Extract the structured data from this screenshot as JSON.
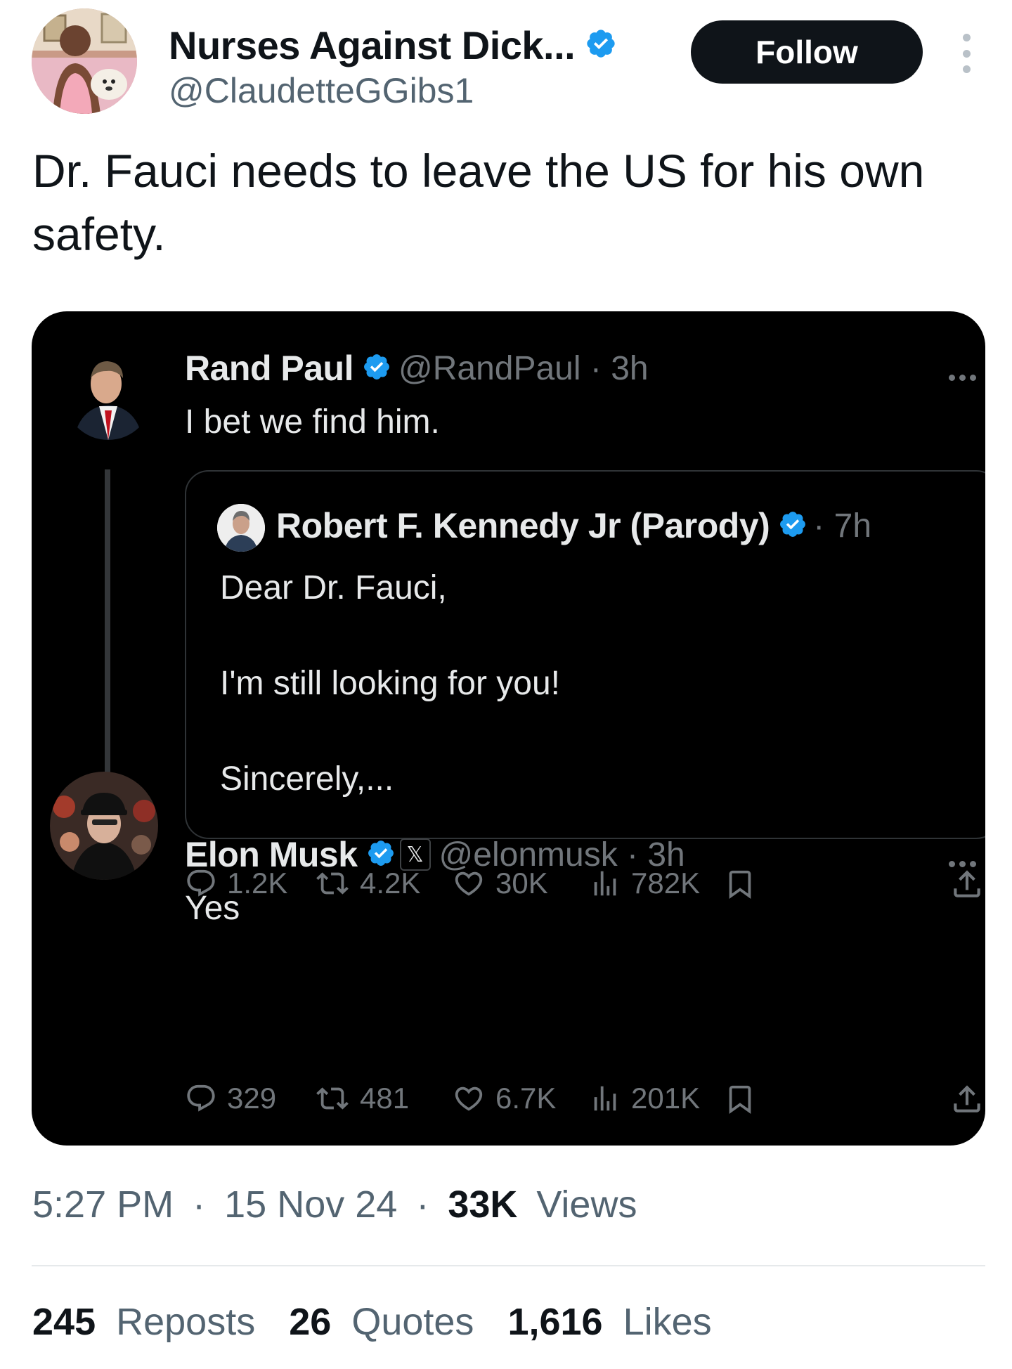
{
  "tweet": {
    "author": {
      "display_name": "Nurses Against Dick...",
      "handle": "@ClaudetteGGibs1",
      "verified": true
    },
    "follow_label": "Follow",
    "text": "Dr. Fauci needs to leave the US for his own safety.",
    "time": "5:27 PM",
    "sep1": "·",
    "date": "15 Nov 24",
    "sep2": "·",
    "views_count": "33K",
    "views_label": "Views",
    "stats": {
      "reposts_count": "245",
      "reposts_label": "Reposts",
      "quotes_count": "26",
      "quotes_label": "Quotes",
      "likes_count": "1,616",
      "likes_label": "Likes"
    }
  },
  "embedded": {
    "rand_paul": {
      "name": "Rand Paul",
      "handle_time": "@RandPaul · 3h",
      "text": "I bet we find him.",
      "quoted": {
        "name": "Robert F. Kennedy Jr (Parody)",
        "time": "· 7h",
        "line1": "Dear Dr. Fauci,",
        "line2": "I'm still looking for you!",
        "line3": "Sincerely,..."
      },
      "actions": {
        "replies": "1.2K",
        "reposts": "4.2K",
        "likes": "30K",
        "views": "782K"
      }
    },
    "elon_musk": {
      "name": "Elon Musk",
      "badge": "𝕏",
      "handle_time": "@elonmusk · 3h",
      "text": "Yes",
      "actions": {
        "replies": "329",
        "reposts": "481",
        "likes": "6.7K",
        "views": "201K"
      }
    }
  },
  "colors": {
    "verified_blue": "#1d9bf0",
    "dark_bg": "#000000",
    "muted_gray": "#536471",
    "dark_muted": "#71767b",
    "follow_bg": "#0f1419"
  },
  "icons": [
    "verified-badge-icon",
    "more-dots-icon",
    "reply-icon",
    "repost-icon",
    "like-icon",
    "views-icon",
    "bookmark-icon",
    "share-icon"
  ]
}
